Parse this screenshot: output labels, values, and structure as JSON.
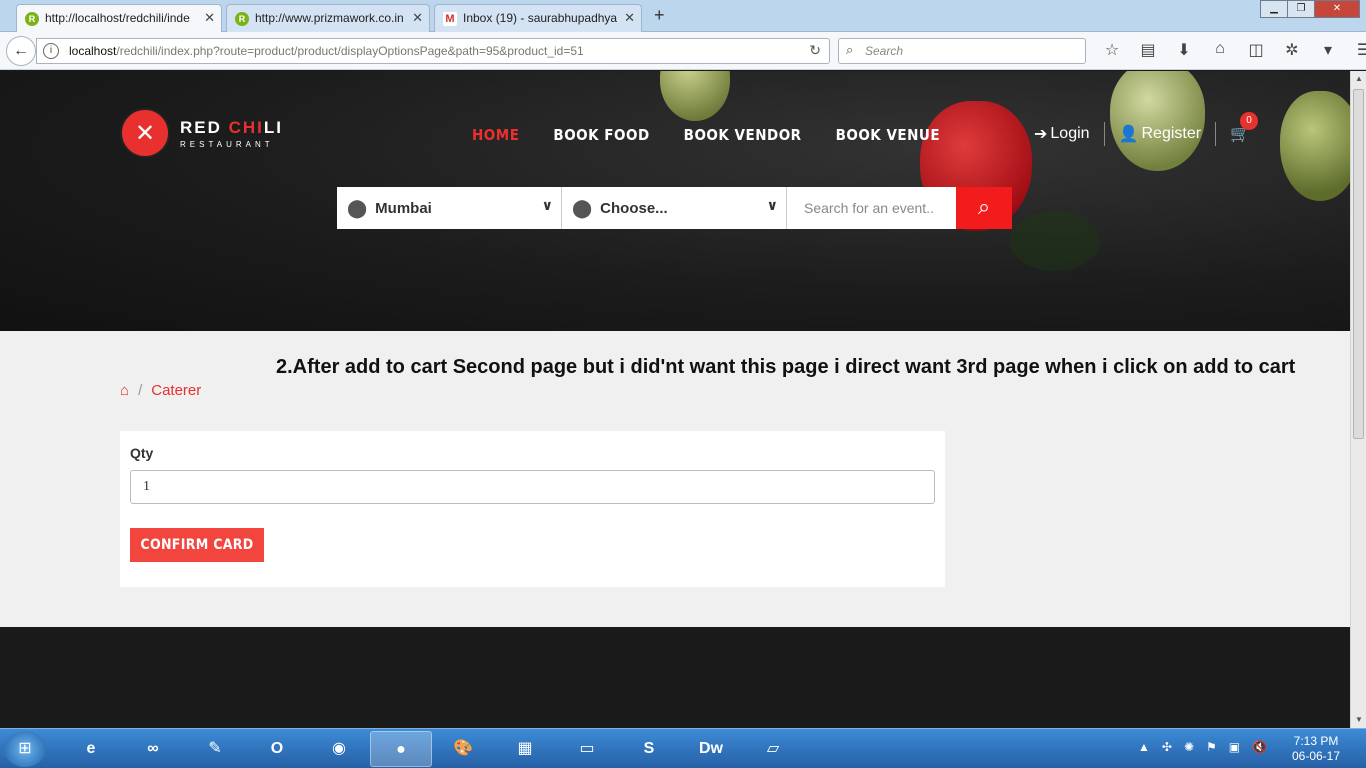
{
  "browser": {
    "tabs": [
      {
        "title": "http://localhost/redchili/inde",
        "icon": "R",
        "active": true
      },
      {
        "title": "http://www.prizmawork.co.in",
        "icon": "R",
        "active": false
      },
      {
        "title": "Inbox (19) - saurabhupadhya",
        "icon": "M",
        "active": false
      }
    ],
    "url_host": "localhost",
    "url_path": "/redchili/index.php?route=product/product/displayOptionsPage&path=95&product_id=51",
    "search_placeholder": "Search"
  },
  "site": {
    "logo": {
      "title_a": "RED ",
      "title_b": "CHI",
      "title_c": "LI",
      "subtitle": "RESTAURANT"
    },
    "menu": [
      "HOME",
      "BOOK FOOD",
      "BOOK VENDOR",
      "BOOK VENUE"
    ],
    "login": "Login",
    "register": "Register",
    "cart_count": "0",
    "city": "Mumbai",
    "venue": "Choose...",
    "event_placeholder": "Search for an event..",
    "breadcrumb": {
      "current": "Caterer",
      "separator": "/"
    },
    "heading": "2.After add to cart Second page but i did'nt want this page i direct want 3rd page when i click on add to cart",
    "form": {
      "qty_label": "Qty",
      "qty_value": "1",
      "button": "CONFIRM CARD"
    }
  },
  "taskbar": {
    "time": "7:13 PM",
    "date": "06-06-17"
  },
  "colors": {
    "accent": "#e8312f",
    "search_button": "#f21c1c",
    "confirm_button": "#f2453d"
  }
}
